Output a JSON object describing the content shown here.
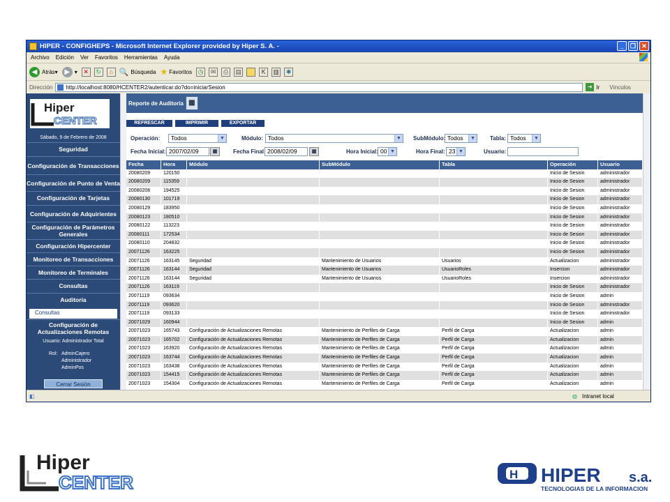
{
  "window": {
    "title": "HIPER - CONFIGHEPS - Microsoft Internet Explorer provided by Hiper S. A. -",
    "menu": [
      "Archivo",
      "Edición",
      "Ver",
      "Favoritos",
      "Herramientas",
      "Ayuda"
    ],
    "toolbar": {
      "back": "Atrás",
      "search": "Búsqueda",
      "favorites": "Favoritos"
    },
    "address_label": "Dirección",
    "address_url": "http://localhost:8080/HCENTER2/autenticar.do?do=iniciarSesion",
    "go_label": "Ir",
    "links_label": "Vínculos",
    "status_zone": "Intranet local"
  },
  "sidebar": {
    "logo_text_top": "Hiper",
    "logo_text_bottom": "CENTER",
    "date": "Sábado, 9 de Febrero de 2008",
    "items": [
      "Seguridad",
      "Configuración de Transacciones",
      "Configuración de Punto de Venta",
      "Configuración de Tarjetas",
      "Configuración de Adquirientes",
      "Configuración de Parámetros Generales",
      "Configuración Hipercenter",
      "Monitoreo de Transacciones",
      "Monitoreo de Terminales",
      "Consultas",
      "Auditoría"
    ],
    "sub_item": "Consultas",
    "last_item": "Configuración de Actualizaciones Remotas",
    "user_line": "Usuario: Administrador Total",
    "rol_label": "Rol:",
    "roles": [
      "AdminCajero",
      "Administrador",
      "AdminPos"
    ],
    "logout": "Cerrar Sesión"
  },
  "report": {
    "title": "Reporte de Auditoría",
    "buttons": [
      "REFRESCAR",
      "IMPRIMIR",
      "EXPORTAR"
    ],
    "filters": {
      "operacion_label": "Operación:",
      "operacion_value": "Todos",
      "modulo_label": "Módulo:",
      "modulo_value": "Todos",
      "submodulo_label": "SubMódulo:",
      "submodulo_value": "Todos",
      "tabla_label": "Tabla:",
      "tabla_value": "Todos",
      "fecha_inicial_label": "Fecha Inicial:",
      "fecha_inicial_value": "2007/02/09",
      "fecha_final_label": "Fecha Final:",
      "fecha_final_value": "2008/02/09",
      "hora_inicial_label": "Hora Inicial:",
      "hora_inicial_value": "00",
      "hora_final_label": "Hora Final:",
      "hora_final_value": "23",
      "usuario_label": "Usuario:",
      "usuario_value": ""
    },
    "columns": [
      "Fecha",
      "Hora",
      "Módulo",
      "SubMódulo",
      "Tabla",
      "Operación",
      "Usuario"
    ],
    "rows": [
      [
        "20080209",
        "120150",
        "",
        "",
        "",
        "Inicio de Sesion",
        "administrador"
      ],
      [
        "20080209",
        "115359",
        "",
        "",
        "",
        "Inicio de Sesion",
        "administrador"
      ],
      [
        "20080208",
        "194525",
        "",
        "",
        "",
        "Inicio de Sesion",
        "administrador"
      ],
      [
        "20080130",
        "101719",
        "",
        "",
        "",
        "Inicio de Sesion",
        "administrador"
      ],
      [
        "20080129",
        "183950",
        "",
        "",
        "",
        "Inicio de Sesion",
        "administrador"
      ],
      [
        "20080123",
        "180510",
        "",
        "",
        "",
        "Inicio de Sesion",
        "administrador"
      ],
      [
        "20080122",
        "113223",
        "",
        "",
        "",
        "Inicio de Sesion",
        "administrador"
      ],
      [
        "20080111",
        "172534",
        "",
        "",
        "",
        "Inicio de Sesion",
        "administrador"
      ],
      [
        "20080110",
        "204832",
        "",
        "",
        "",
        "Inicio de Sesion",
        "administrador"
      ],
      [
        "20071126",
        "163225",
        "",
        "",
        "",
        "Inicio de Sesion",
        "administrador"
      ],
      [
        "20071126",
        "163145",
        "Seguridad",
        "Mantenimiento de Usuarios",
        "Usuarios",
        "Actualizacion",
        "administrador"
      ],
      [
        "20071126",
        "163144",
        "Seguridad",
        "Mantenimiento de Usuarios",
        "UsuarioRoles",
        "Insercion",
        "administrador"
      ],
      [
        "20071126",
        "163144",
        "Seguridad",
        "Mantenimiento de Usuarios",
        "UsuarioRoles",
        "Insercion",
        "administrador"
      ],
      [
        "20071126",
        "163119",
        "",
        "",
        "",
        "Inicio de Sesion",
        "administrador"
      ],
      [
        "20071119",
        "093634",
        "",
        "",
        "",
        "Inicio de Sesion",
        "admin"
      ],
      [
        "20071119",
        "093620",
        "",
        "",
        "",
        "Inicio de Sesion",
        "administrador"
      ],
      [
        "20071119",
        "093133",
        "",
        "",
        "",
        "Inicio de Sesion",
        "administrador"
      ],
      [
        "20071029",
        "160944",
        "",
        "",
        "",
        "Inicio de Sesion",
        "admin"
      ],
      [
        "20071023",
        "165743",
        "Configuración de Actualizaciones Remotas",
        "Mantenimiento de Perfiles de Carga",
        "Perfil de Carga",
        "Actualizacion",
        "admin"
      ],
      [
        "20071023",
        "165702",
        "Configuración de Actualizaciones Remotas",
        "Mantenimiento de Perfiles de Carga",
        "Perfil de Carga",
        "Actualizacion",
        "admin"
      ],
      [
        "20071023",
        "163920",
        "Configuración de Actualizaciones Remotas",
        "Mantenimiento de Perfiles de Carga",
        "Perfil de Carga",
        "Actualizacion",
        "admin"
      ],
      [
        "20071023",
        "163744",
        "Configuración de Actualizaciones Remotas",
        "Mantenimiento de Perfiles de Carga",
        "Perfil de Carga",
        "Actualizacion",
        "admin"
      ],
      [
        "20071023",
        "163438",
        "Configuración de Actualizaciones Remotas",
        "Mantenimiento de Perfiles de Carga",
        "Perfil de Carga",
        "Actualizacion",
        "admin"
      ],
      [
        "20071023",
        "154415",
        "Configuración de Actualizaciones Remotas",
        "Mantenimiento de Perfiles de Carga",
        "Perfil de Carga",
        "Actualizacion",
        "admin"
      ],
      [
        "20071023",
        "154304",
        "Configuración de Actualizaciones Remotas",
        "Mantenimiento de Perfiles de Carga",
        "Perfil de Carga",
        "Actualizacion",
        "admin"
      ]
    ]
  },
  "footer": {
    "logo_top": "Hiper",
    "logo_bottom": "CENTER",
    "corp_name": "HIPER",
    "corp_suffix": "s.a.",
    "corp_tagline": "TECNOLOGIAS DE LA INFORMACION"
  }
}
